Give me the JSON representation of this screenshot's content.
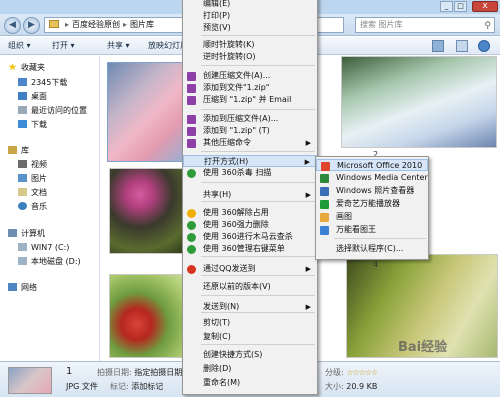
{
  "window": {
    "close_glyph": "x",
    "min_glyph": "_",
    "max_glyph": "□"
  },
  "addressbar": {
    "path": [
      "百度经验原创",
      "图片库"
    ],
    "sep": "▸",
    "search_placeholder": "搜索 图片库"
  },
  "toolbar": {
    "organize": "组织 ▾",
    "open": "打开 ▾",
    "share": "共享 ▾",
    "slideshow": "放映幻灯片"
  },
  "nav": {
    "favorites": "收藏夹",
    "favorites_items": [
      "2345下载",
      "桌面",
      "最近访问的位置",
      "下载"
    ],
    "libraries": "库",
    "libraries_items": [
      "视频",
      "图片",
      "文档",
      "音乐"
    ],
    "computer": "计算机",
    "computer_items": [
      "WIN7 (C:)",
      "本地磁盘 (D:)"
    ],
    "network": "网络"
  },
  "content": {
    "captions": [
      "2",
      "4"
    ]
  },
  "details": {
    "count": "1",
    "type": "JPG 文件",
    "date_label": "拍摄日期:",
    "date_value": "指定拍摄日期",
    "tags_label": "标记:",
    "tags_value": "添加标记",
    "rating_label": "分级:",
    "rating_stars": "☆☆☆☆☆",
    "size_label": "大小:",
    "size_value": "20.9 KB"
  },
  "context_menu": {
    "items": [
      {
        "label": "编辑(E)",
        "icon": ""
      },
      {
        "label": "打印(P)",
        "icon": ""
      },
      {
        "label": "预览(V)",
        "icon": ""
      },
      {
        "label": "顺时针旋转(K)",
        "icon": ""
      },
      {
        "label": "逆时针旋转(O)",
        "icon": ""
      },
      {
        "label": "创建压缩文件(A)...",
        "icon": "winrar-icon"
      },
      {
        "label": "添加到文件\"1.zip\"",
        "icon": "winrar-icon"
      },
      {
        "label": "压缩到 \"1.zip\" 并 Email",
        "icon": "winrar-icon"
      },
      {
        "label": "添加到压缩文件(A)...",
        "icon": "winrar-icon"
      },
      {
        "label": "添加到 \"1.zip\" (T)",
        "icon": "winrar-icon"
      },
      {
        "label": "其他压缩命令",
        "icon": "winrar-icon",
        "submenu": true
      },
      {
        "label": "打开方式(H)",
        "icon": "",
        "submenu": true,
        "highlighted": true
      },
      {
        "label": "使用 360杀毒 扫描",
        "icon": "360-antivirus-icon"
      },
      {
        "label": "共享(H)",
        "icon": "",
        "submenu": true
      },
      {
        "label": "使用 360解除占用",
        "icon": "360-unlock-icon"
      },
      {
        "label": "使用 360强力删除",
        "icon": "360-delete-icon"
      },
      {
        "label": "使用 360进行木马云查杀",
        "icon": "360-trojan-icon"
      },
      {
        "label": "使用 360管理右键菜单",
        "icon": "360-menu-icon"
      },
      {
        "label": "通过QQ发送到",
        "icon": "qq-icon",
        "submenu": true
      },
      {
        "label": "还原以前的版本(V)",
        "icon": ""
      },
      {
        "label": "发送到(N)",
        "icon": "",
        "submenu": true
      },
      {
        "label": "剪切(T)",
        "icon": ""
      },
      {
        "label": "复制(C)",
        "icon": ""
      },
      {
        "label": "创建快捷方式(S)",
        "icon": ""
      },
      {
        "label": "删除(D)",
        "icon": ""
      },
      {
        "label": "重命名(M)",
        "icon": ""
      }
    ],
    "submenu_arrow": "▶"
  },
  "open_with_menu": {
    "items": [
      {
        "label": "Microsoft Office 2010",
        "icon": "office-icon",
        "highlighted": true
      },
      {
        "label": "Windows Media Center",
        "icon": "media-center-icon"
      },
      {
        "label": "Windows 照片查看器",
        "icon": "photo-viewer-icon"
      },
      {
        "label": "爱奇艺万能播放器",
        "icon": "iqiyi-player-icon"
      },
      {
        "label": "画图",
        "icon": "paint-icon"
      },
      {
        "label": "万能看图王",
        "icon": "image-viewer-icon"
      },
      {
        "label": "选择默认程序(C)...",
        "icon": ""
      }
    ]
  },
  "watermark": "Bai经验",
  "colors": {
    "menu_highlight": "#d6e6f8",
    "titlebar": "#bcd6ef",
    "close": "#c7453a"
  }
}
